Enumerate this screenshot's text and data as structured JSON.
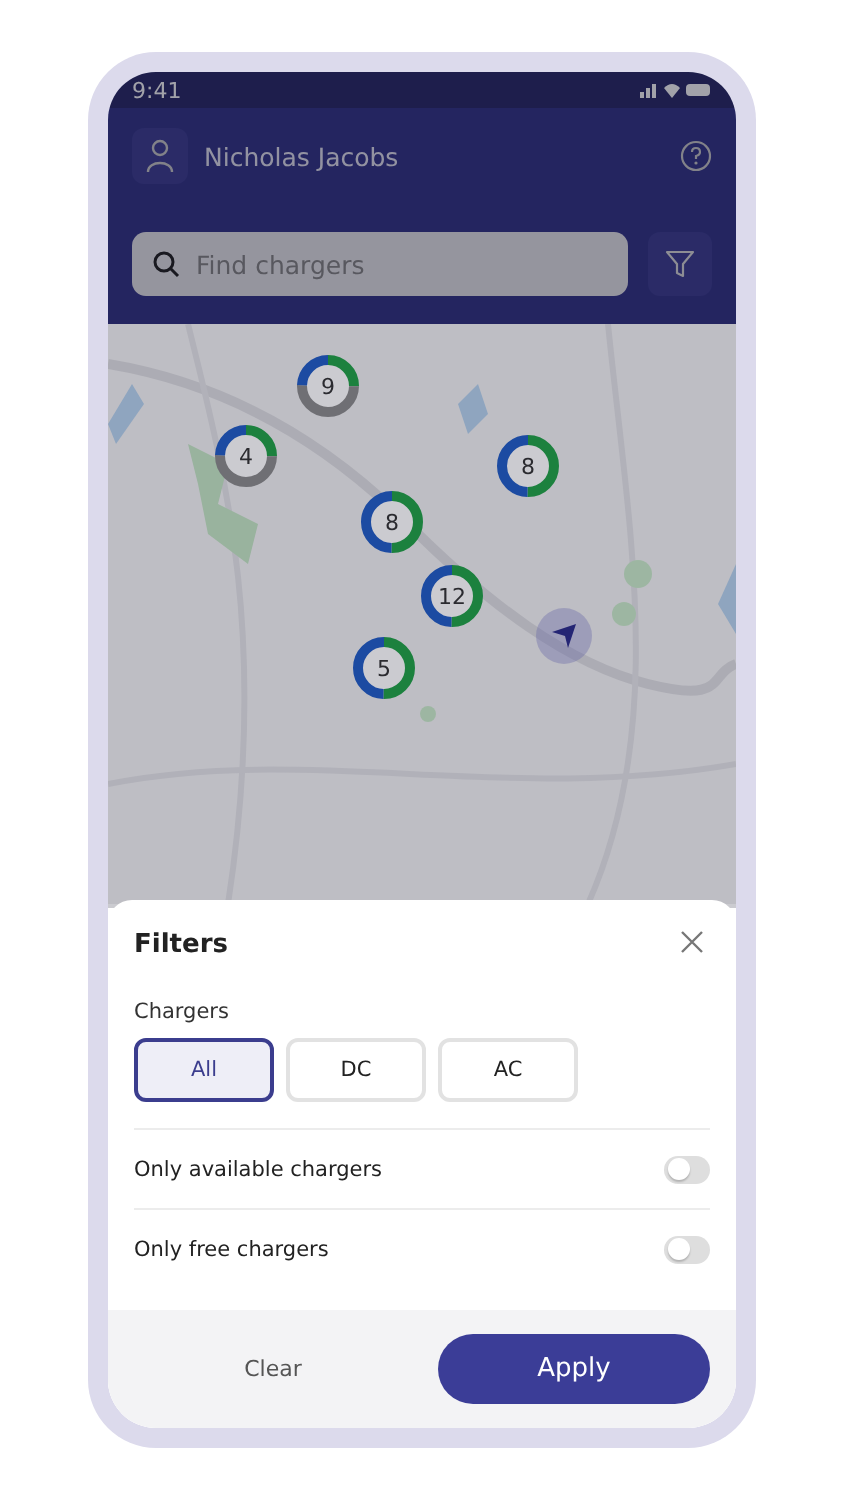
{
  "status_bar": {
    "time": "9:41"
  },
  "header": {
    "user_name": "Nicholas Jacobs"
  },
  "search": {
    "placeholder": "Find chargers"
  },
  "map": {
    "kind": "picture",
    "clusters": [
      {
        "count": "9",
        "kind": "mixed"
      },
      {
        "count": "4",
        "kind": "mixed"
      },
      {
        "count": "8",
        "kind": "available"
      },
      {
        "count": "8",
        "kind": "available"
      },
      {
        "count": "12",
        "kind": "available"
      },
      {
        "count": "5",
        "kind": "available"
      }
    ]
  },
  "filters": {
    "title": "Filters",
    "section_label": "Chargers",
    "charger_types": [
      {
        "label": "All",
        "selected": true
      },
      {
        "label": "DC",
        "selected": false
      },
      {
        "label": "AC",
        "selected": false
      }
    ],
    "options": [
      {
        "label": "Only available chargers",
        "on": false
      },
      {
        "label": "Only free chargers",
        "on": false
      }
    ],
    "clear_label": "Clear",
    "apply_label": "Apply"
  }
}
